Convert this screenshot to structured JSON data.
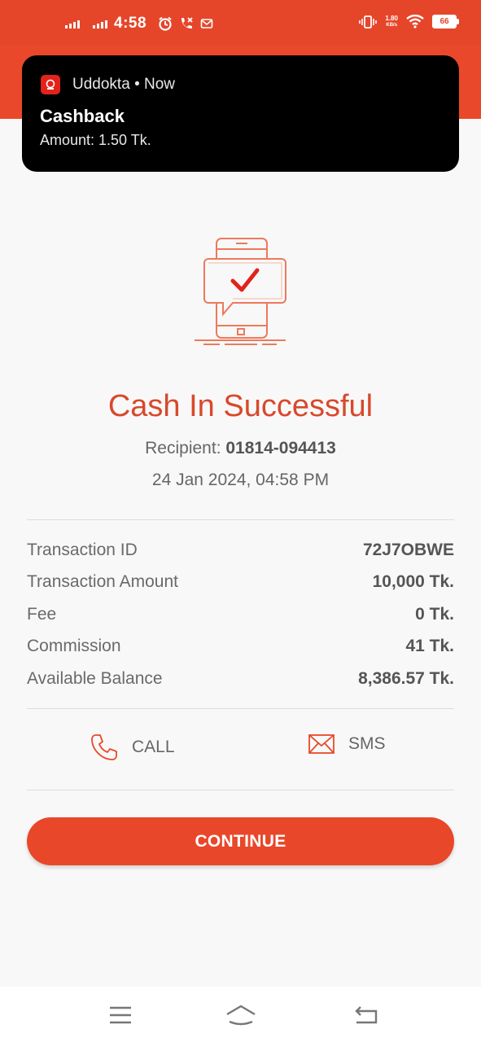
{
  "status_bar": {
    "time": "4:58",
    "net_speed_value": "1.80",
    "net_speed_unit": "KB/s",
    "battery": "66"
  },
  "notification": {
    "app_name": "Uddokta",
    "time": "Now",
    "title": "Cashback",
    "body": "Amount: 1.50 Tk."
  },
  "result": {
    "title": "Cash In Successful",
    "recipient_label": "Recipient:",
    "recipient_number": "01814-094413",
    "datetime": "24 Jan 2024, 04:58 PM"
  },
  "details": [
    {
      "label": "Transaction ID",
      "value": "72J7OBWE"
    },
    {
      "label": "Transaction Amount",
      "value": "10,000 Tk."
    },
    {
      "label": "Fee",
      "value": "0 Tk."
    },
    {
      "label": "Commission",
      "value": "41 Tk."
    },
    {
      "label": "Available Balance",
      "value": "8,386.57 Tk."
    }
  ],
  "actions": {
    "call_label": "CALL",
    "sms_label": "SMS"
  },
  "continue_label": "CONTINUE",
  "colors": {
    "brand": "#e9492a",
    "title": "#d9482c",
    "check": "#e2231a"
  },
  "icons": [
    "signal-icon",
    "alarm-icon",
    "missed-call-icon",
    "message-icon",
    "vibrate-icon",
    "wifi-icon",
    "battery-icon",
    "phone-icon",
    "envelope-icon",
    "menu-icon",
    "home-icon",
    "back-icon"
  ]
}
